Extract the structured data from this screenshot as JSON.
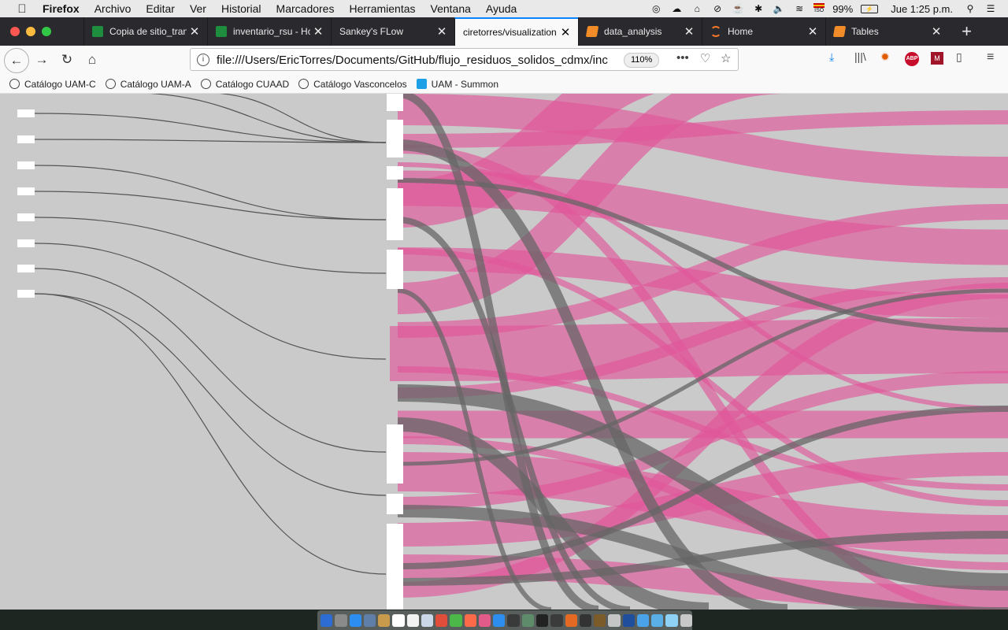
{
  "menubar": {
    "app": "Firefox",
    "items": [
      "Archivo",
      "Editar",
      "Ver",
      "Historial",
      "Marcadores",
      "Herramientas",
      "Ventana",
      "Ayuda"
    ],
    "battery": "99%",
    "clock": "Jue 1:25 p.m.",
    "input_source": "ISO"
  },
  "tabs": [
    {
      "title": "Copia de sitio_tran",
      "icon": "sheets-icon",
      "color": "#1e8e3e"
    },
    {
      "title": "inventario_rsu - Ho",
      "icon": "sheets-icon",
      "color": "#1e8e3e"
    },
    {
      "title": "Sankey's FLow",
      "icon": "",
      "color": ""
    },
    {
      "title": "ciretorres/visualization",
      "icon": "",
      "color": "",
      "active": true
    },
    {
      "title": "data_analysis",
      "icon": "notebook-icon",
      "color": "#f28c28"
    },
    {
      "title": "Home",
      "icon": "jupyter-icon",
      "color": "#f37726"
    },
    {
      "title": "Tables",
      "icon": "notebook-icon",
      "color": "#f28c28"
    }
  ],
  "navbar": {
    "url": "file:///Users/EricTorres/Documents/GitHub/flujo_residuos_solidos_cdmx/inc",
    "zoom": "110%",
    "more": "•••"
  },
  "bookmarks": [
    {
      "label": "Catálogo UAM-C"
    },
    {
      "label": "Catálogo UAM-A"
    },
    {
      "label": "Catálogo CUAAD"
    },
    {
      "label": "Catálogo Vasconcelos"
    },
    {
      "label": "UAM - Summon"
    }
  ],
  "sankey": {
    "link_color_primary": "#e0569a",
    "link_color_secondary": "#666666",
    "node_color": "#ffffff",
    "background": "#cacaca"
  }
}
